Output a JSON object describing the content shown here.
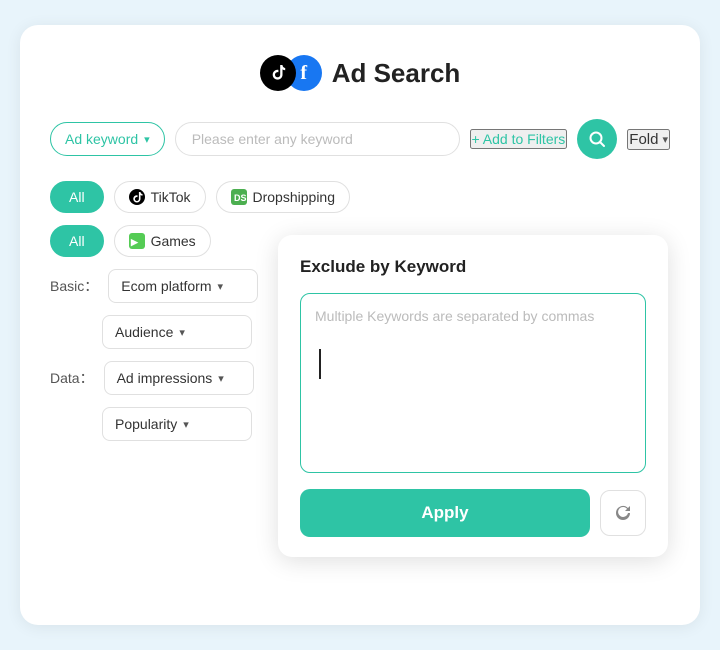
{
  "header": {
    "title": "Ad Search",
    "tiktok_icon": "tiktok",
    "fb_icon": "facebook"
  },
  "search_bar": {
    "keyword_btn_label": "Ad keyword",
    "input_placeholder": "Please enter any keyword",
    "add_filter_label": "+ Add to Filters",
    "search_icon": "search",
    "fold_label": "Fold",
    "chevron_icon": "chevron-down"
  },
  "filter_tags": {
    "all_label": "All",
    "tiktok_label": "TikTok",
    "dropshipping_label": "Dropshipping",
    "games_label": "Games",
    "all2_label": "All"
  },
  "filters": {
    "basic_label": "Basic：",
    "ecom_platform_label": "Ecom platform",
    "audience_label": "Audience",
    "data_label": "Data：",
    "ad_impressions_label": "Ad impressions",
    "popularity_label": "Popularity"
  },
  "popup": {
    "title": "Exclude by Keyword",
    "textarea_placeholder": "Multiple Keywords are separated by commas",
    "apply_label": "Apply",
    "reset_icon": "refresh"
  }
}
